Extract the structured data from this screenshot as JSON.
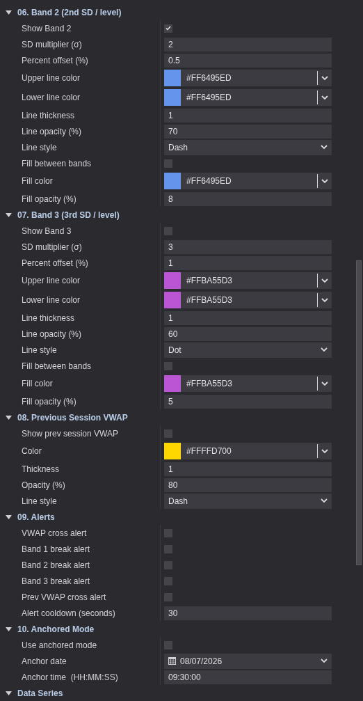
{
  "sections": [
    {
      "title": "06. Band 2 (2nd SD / level)",
      "expanded": true,
      "rows": [
        {
          "kind": "checkbox",
          "label": "Show Band 2",
          "checked": true
        },
        {
          "kind": "text",
          "label": "SD multiplier (σ)",
          "value": "2"
        },
        {
          "kind": "text",
          "label": "Percent offset (%)",
          "value": "0.5"
        },
        {
          "kind": "color",
          "label": "Upper line color",
          "value": "#FF6495ED",
          "color": "#6495ed"
        },
        {
          "kind": "color",
          "label": "Lower line color",
          "value": "#FF6495ED",
          "color": "#6495ed"
        },
        {
          "kind": "text",
          "label": "Line thickness",
          "value": "1"
        },
        {
          "kind": "text",
          "label": "Line opacity (%)",
          "value": "70"
        },
        {
          "kind": "select",
          "label": "Line style",
          "value": "Dash"
        },
        {
          "kind": "checkbox",
          "label": "Fill between bands",
          "checked": false
        },
        {
          "kind": "color",
          "label": "Fill color",
          "value": "#FF6495ED",
          "color": "#6495ed"
        },
        {
          "kind": "text",
          "label": "Fill opacity (%)",
          "value": "8"
        }
      ]
    },
    {
      "title": "07. Band 3 (3rd SD / level)",
      "expanded": true,
      "rows": [
        {
          "kind": "checkbox",
          "label": "Show Band 3",
          "checked": false
        },
        {
          "kind": "text",
          "label": "SD multiplier (σ)",
          "value": "3"
        },
        {
          "kind": "text",
          "label": "Percent offset (%)",
          "value": "1"
        },
        {
          "kind": "color",
          "label": "Upper line color",
          "value": "#FFBA55D3",
          "color": "#ba55d3"
        },
        {
          "kind": "color",
          "label": "Lower line color",
          "value": "#FFBA55D3",
          "color": "#ba55d3"
        },
        {
          "kind": "text",
          "label": "Line thickness",
          "value": "1"
        },
        {
          "kind": "text",
          "label": "Line opacity (%)",
          "value": "60"
        },
        {
          "kind": "select",
          "label": "Line style",
          "value": "Dot"
        },
        {
          "kind": "checkbox",
          "label": "Fill between bands",
          "checked": false
        },
        {
          "kind": "color",
          "label": "Fill color",
          "value": "#FFBA55D3",
          "color": "#ba55d3"
        },
        {
          "kind": "text",
          "label": "Fill opacity (%)",
          "value": "5"
        }
      ]
    },
    {
      "title": "08. Previous Session VWAP",
      "expanded": true,
      "rows": [
        {
          "kind": "checkbox",
          "label": "Show prev session VWAP",
          "checked": false
        },
        {
          "kind": "color",
          "label": "Color",
          "value": "#FFFFD700",
          "color": "#ffd700"
        },
        {
          "kind": "text",
          "label": "Thickness",
          "value": "1"
        },
        {
          "kind": "text",
          "label": "Opacity (%)",
          "value": "80"
        },
        {
          "kind": "select",
          "label": "Line style",
          "value": "Dash"
        }
      ]
    },
    {
      "title": "09. Alerts",
      "expanded": true,
      "rows": [
        {
          "kind": "checkbox",
          "label": "VWAP cross alert",
          "checked": false
        },
        {
          "kind": "checkbox",
          "label": "Band 1 break alert",
          "checked": false
        },
        {
          "kind": "checkbox",
          "label": "Band 2 break alert",
          "checked": false
        },
        {
          "kind": "checkbox",
          "label": "Band 3 break alert",
          "checked": false
        },
        {
          "kind": "checkbox",
          "label": "Prev VWAP cross alert",
          "checked": false
        },
        {
          "kind": "text",
          "label": "Alert cooldown (seconds)",
          "value": "30"
        }
      ]
    },
    {
      "title": "10. Anchored Mode",
      "expanded": true,
      "rows": [
        {
          "kind": "checkbox",
          "label": "Use anchored mode",
          "checked": false
        },
        {
          "kind": "date",
          "label": "Anchor date",
          "value": "08/07/2026"
        },
        {
          "kind": "text",
          "label": "Anchor time  (HH:MM:SS)",
          "value": "09:30:00"
        }
      ]
    },
    {
      "title": "Data Series",
      "expanded": true
    }
  ]
}
